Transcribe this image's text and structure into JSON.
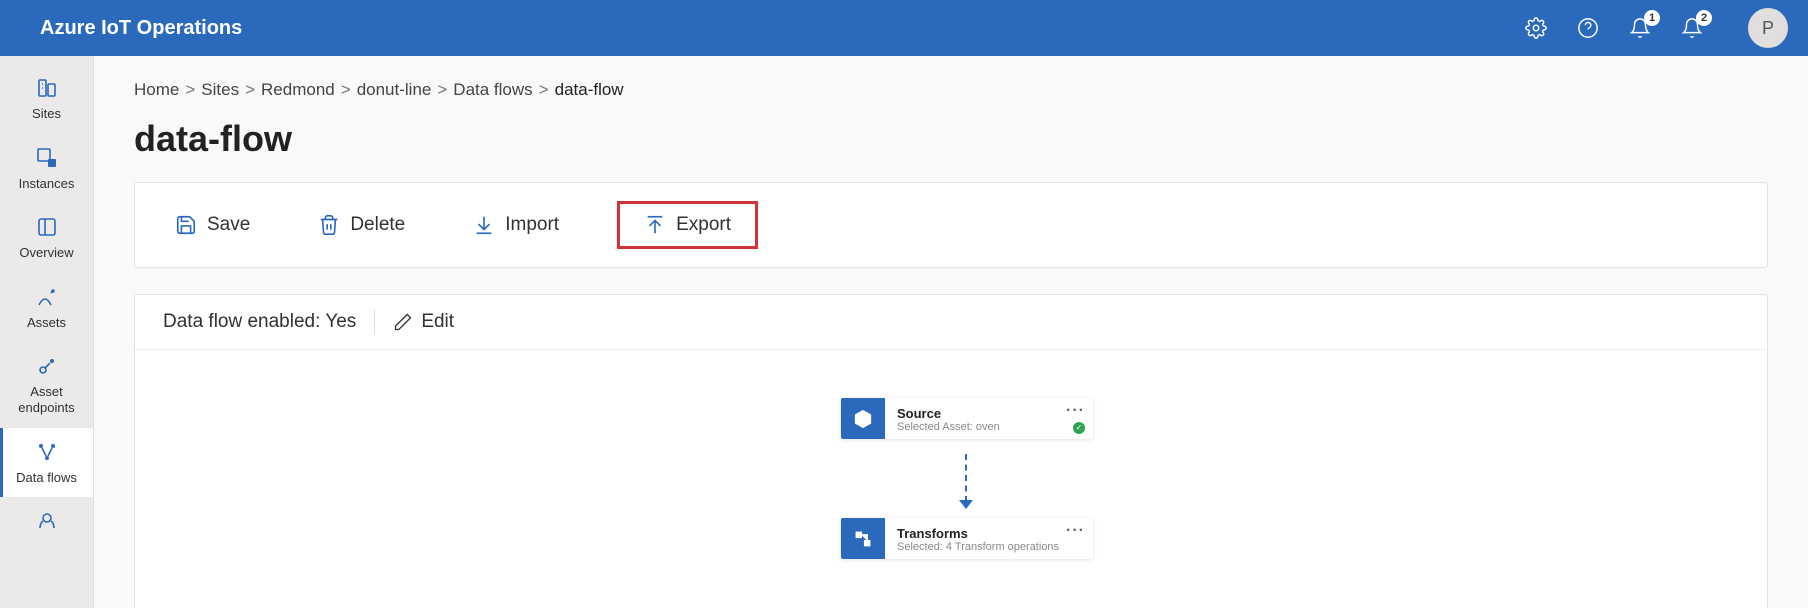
{
  "app": {
    "title": "Azure IoT Operations"
  },
  "header": {
    "notifications1_count": "1",
    "notifications2_count": "2",
    "avatar_initial": "P"
  },
  "sidebar": {
    "items": [
      {
        "label": "Sites"
      },
      {
        "label": "Instances"
      },
      {
        "label": "Overview"
      },
      {
        "label": "Assets"
      },
      {
        "label": "Asset endpoints"
      },
      {
        "label": "Data flows"
      }
    ]
  },
  "breadcrumb": {
    "items": [
      "Home",
      "Sites",
      "Redmond",
      "donut-line",
      "Data flows"
    ],
    "current": "data-flow",
    "sep": ">"
  },
  "page": {
    "title": "data-flow"
  },
  "toolbar": {
    "save": "Save",
    "delete": "Delete",
    "import": "Import",
    "export": "Export"
  },
  "status": {
    "enabled_label": "Data flow enabled: Yes",
    "edit_label": "Edit"
  },
  "flow": {
    "nodes": [
      {
        "title": "Source",
        "subtitle": "Selected Asset: oven"
      },
      {
        "title": "Transforms",
        "subtitle": "Selected: 4 Transform operations"
      }
    ]
  }
}
